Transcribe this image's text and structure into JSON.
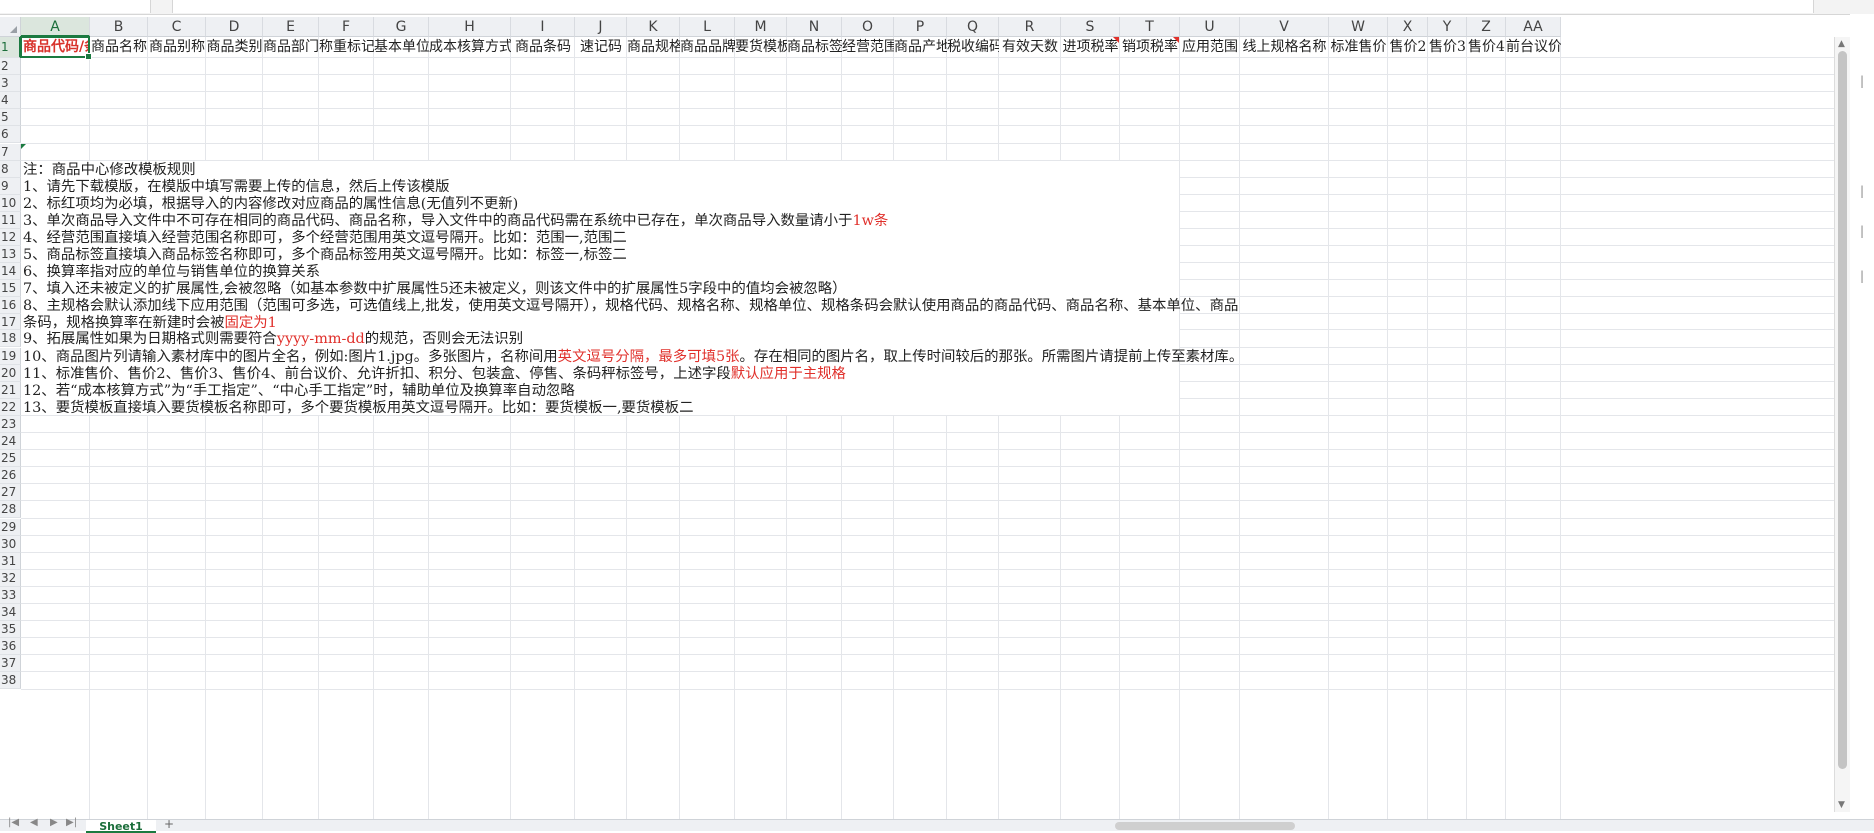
{
  "columns": [
    {
      "letter": "A",
      "header": "商品代码/条"
    },
    {
      "letter": "B",
      "header": "商品名称"
    },
    {
      "letter": "C",
      "header": "商品别称"
    },
    {
      "letter": "D",
      "header": "商品类别"
    },
    {
      "letter": "E",
      "header": "商品部门"
    },
    {
      "letter": "F",
      "header": "称重标记"
    },
    {
      "letter": "G",
      "header": "基本单位"
    },
    {
      "letter": "H",
      "header": "成本核算方式"
    },
    {
      "letter": "I",
      "header": "商品条码"
    },
    {
      "letter": "J",
      "header": "速记码"
    },
    {
      "letter": "K",
      "header": "商品规格"
    },
    {
      "letter": "L",
      "header": "商品品牌"
    },
    {
      "letter": "M",
      "header": "要货模板"
    },
    {
      "letter": "N",
      "header": "商品标签"
    },
    {
      "letter": "O",
      "header": "经营范围"
    },
    {
      "letter": "P",
      "header": "商品产地"
    },
    {
      "letter": "Q",
      "header": "税收编码"
    },
    {
      "letter": "R",
      "header": "有效天数"
    },
    {
      "letter": "S",
      "header": "进项税率"
    },
    {
      "letter": "T",
      "header": "销项税率"
    },
    {
      "letter": "U",
      "header": "应用范围"
    },
    {
      "letter": "V",
      "header": "线上规格名称"
    },
    {
      "letter": "W",
      "header": "标准售价"
    },
    {
      "letter": "X",
      "header": "售价2"
    },
    {
      "letter": "Y",
      "header": "售价3"
    },
    {
      "letter": "Z",
      "header": "售价4"
    },
    {
      "letter": "AA",
      "header": "前台议价"
    }
  ],
  "rows": [
    "1",
    "2",
    "3",
    "4",
    "5",
    "6",
    "7",
    "8",
    "9",
    "10",
    "11",
    "12",
    "13",
    "14",
    "15",
    "16",
    "17",
    "18",
    "19",
    "20",
    "21",
    "22",
    "23",
    "24",
    "25",
    "26",
    "27",
    "28",
    "29",
    "30",
    "31",
    "32",
    "33",
    "34",
    "35",
    "36",
    "37",
    "38"
  ],
  "notes": [
    {
      "parts": [
        {
          "t": "注：商品中心修改模板规则"
        }
      ]
    },
    {
      "parts": [
        {
          "t": "1、请先下载模版，在模版中填写需要上传的信息，然后上传该模版"
        }
      ]
    },
    {
      "parts": [
        {
          "t": "2、标红项均为必填，根据导入的内容修改对应商品的属性信息(无值列不更新)"
        }
      ]
    },
    {
      "parts": [
        {
          "t": "3、单次商品导入文件中不可存在相同的商品代码、商品名称，导入文件中的商品代码需在系统中已存在，单次商品导入数量请小于"
        },
        {
          "t": "1w条",
          "red": true
        }
      ]
    },
    {
      "parts": [
        {
          "t": "4、经营范围直接填入经营范围名称即可，多个经营范围用英文逗号隔开。比如：范围一,范围二"
        }
      ]
    },
    {
      "parts": [
        {
          "t": "5、商品标签直接填入商品标签名称即可，多个商品标签用英文逗号隔开。比如：标签一,标签二"
        }
      ]
    },
    {
      "parts": [
        {
          "t": "6、换算率指对应的单位与销售单位的换算关系"
        }
      ]
    },
    {
      "parts": [
        {
          "t": "7、填入还未被定义的扩展属性,会被忽略（如基本参数中扩展属性5还未被定义，则该文件中的扩展属性5字段中的值均会被忽略）"
        }
      ]
    },
    {
      "parts": [
        {
          "t": "8、主规格会默认添加线下应用范围（范围可多选，可选值线上,批发，使用英文逗号隔开），规格代码、规格名称、规格单位、规格条码会默认使用商品的商品代码、商品名称、基本单位、商品"
        }
      ]
    },
    {
      "parts": [
        {
          "t": "条码，规格换算率在新建时会被"
        },
        {
          "t": "固定为1",
          "red": true
        }
      ]
    },
    {
      "parts": [
        {
          "t": "9、拓展属性如果为日期格式则需要符合"
        },
        {
          "t": "yyyy-mm-dd",
          "red": true
        },
        {
          "t": "的规范，否则会无法识别"
        }
      ]
    },
    {
      "parts": [
        {
          "t": "10、商品图片列请输入素材库中的图片全名，例如:图片1.jpg。多张图片，名称间用"
        },
        {
          "t": "英文逗号分隔，最多可填5张",
          "red": true
        },
        {
          "t": "。存在相同的图片名，取上传时间较后的那张。所需图片请提前上传至素材库。"
        }
      ]
    },
    {
      "parts": [
        {
          "t": "11、标准售价、售价2、售价3、售价4、前台议价、允许折扣、积分、包装盒、停售、条码秤标签号，上述字段"
        },
        {
          "t": "默认应用于主规格",
          "red": true
        }
      ]
    },
    {
      "parts": [
        {
          "t": "12、若“成本核算方式”为“手工指定”、“中心手工指定”时，辅助单位及换算率自动忽略"
        }
      ]
    },
    {
      "parts": [
        {
          "t": "13、要货模板直接填入要货模板名称即可，多个要货模板用英文逗号隔开。比如：要货模板一,要货模板二"
        }
      ]
    }
  ],
  "sheet_tab": "Sheet1",
  "colors": {
    "accent": "#1b7a40",
    "required_red": "#e0302b",
    "header_bg": "#eef0f3",
    "grid": "#e4e6ea"
  }
}
